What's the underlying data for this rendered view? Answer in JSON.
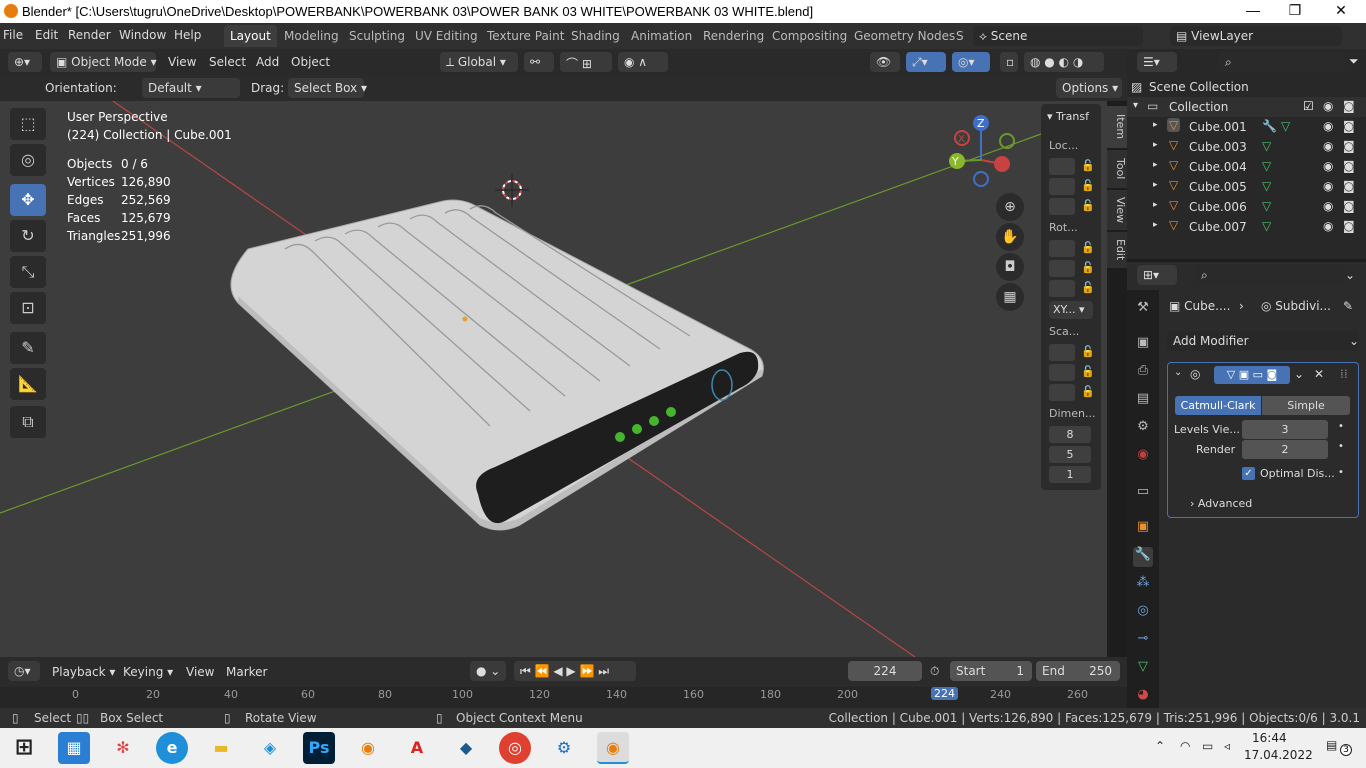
{
  "window": {
    "title": "Blender* [C:\\Users\\tugru\\OneDrive\\Desktop\\POWERBANK\\POWERBANK 03\\POWER BANK 03 WHITE\\POWERBANK 03 WHITE.blend]",
    "minimize": "—",
    "restore": "❐",
    "close": "✕"
  },
  "menu": {
    "file": "File",
    "edit": "Edit",
    "render": "Render",
    "window": "Window",
    "help": "Help"
  },
  "workspaces": [
    "Layout",
    "Modeling",
    "Sculpting",
    "UV Editing",
    "Texture Paint",
    "Shading",
    "Animation",
    "Rendering",
    "Compositing",
    "Geometry Nodes",
    "S"
  ],
  "scene": {
    "name": "Scene",
    "view_layer": "ViewLayer"
  },
  "header": {
    "mode": "Object Mode",
    "view": "View",
    "select": "Select",
    "add": "Add",
    "object": "Object",
    "transform": "Global"
  },
  "tool_settings": {
    "orientation_label": "Orientation:",
    "orientation_value": "Default",
    "drag_label": "Drag:",
    "drag_value": "Select Box",
    "options": "Options"
  },
  "overlay_stats": {
    "perspective": "User Perspective",
    "collection": "(224) Collection | Cube.001",
    "objects_label": "Objects",
    "objects": "0 / 6",
    "vertices_label": "Vertices",
    "vertices": "126,890",
    "edges_label": "Edges",
    "edges": "252,569",
    "faces_label": "Faces",
    "faces": "125,679",
    "triangles_label": "Triangles",
    "triangles": "251,996"
  },
  "gizmo": {
    "z": "Z",
    "y": "Y",
    "x": "X"
  },
  "npanel": {
    "section": "Transf",
    "location": "Loc...",
    "rotation": "Rot...",
    "mode": "XY...",
    "scale": "Sca...",
    "dimensions": "Dimen...",
    "dim_values": [
      "8",
      "5",
      "1"
    ],
    "tabs": [
      "Item",
      "Tool",
      "View",
      "Edit"
    ]
  },
  "outliner": {
    "root": "Scene Collection",
    "collection": "Collection",
    "objects": [
      "Cube.001",
      "Cube.003",
      "Cube.004",
      "Cube.005",
      "Cube.006",
      "Cube.007"
    ]
  },
  "properties": {
    "breadcrumb_object": "Cube....",
    "breadcrumb_modifier": "Subdivi...",
    "add_modifier": "Add Modifier",
    "tab_catmull": "Catmull-Clark",
    "tab_simple": "Simple",
    "levels_label": "Levels Vie...",
    "levels_value": "3",
    "render_label": "Render",
    "render_value": "2",
    "optimal_label": "Optimal Dis...",
    "optimal_checked": true,
    "advanced": "Advanced"
  },
  "timeline": {
    "playback": "Playback",
    "keying": "Keying",
    "view": "View",
    "marker": "Marker",
    "current_frame": "224",
    "start_label": "Start",
    "start": "1",
    "end_label": "End",
    "end": "250",
    "ruler": [
      "0",
      "20",
      "40",
      "60",
      "80",
      "100",
      "120",
      "140",
      "160",
      "180",
      "200",
      "224",
      "240",
      "260"
    ]
  },
  "status": {
    "select": "Select",
    "box_select": "Box Select",
    "rotate_view": "Rotate View",
    "context_menu": "Object Context Menu",
    "info": "Collection | Cube.001 | Verts:126,890 | Faces:125,679 | Tris:251,996 | Objects:0/6 | 3.0.1"
  },
  "taskbar": {
    "time": "16:44",
    "date": "17.04.2022",
    "notifications": "3"
  },
  "colors": {
    "accent": "#4772b3",
    "viewport_bg": "#3d3d3d",
    "x_axis": "#c84242",
    "y_axis": "#6a9a2a",
    "led": "#46b52e"
  }
}
